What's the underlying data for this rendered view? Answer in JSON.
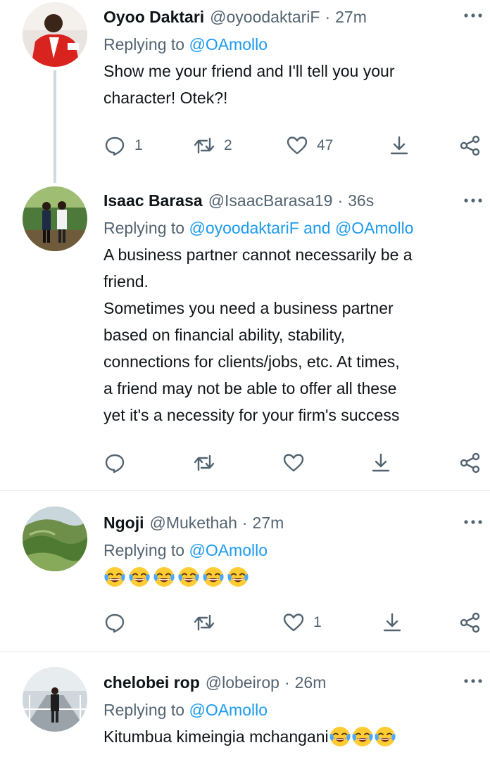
{
  "colors": {
    "text": "#0f1419",
    "muted": "#536471",
    "link": "#1d9bf0",
    "divider": "#e6ecf0",
    "thread": "#cfd9de"
  },
  "common": {
    "replying_prefix": "Replying to ",
    "dot": "·",
    "and": " and "
  },
  "tweets": [
    {
      "name": "Oyoo Daktari",
      "handle": "@oyoodaktariF",
      "time": "27m",
      "replying_to": [
        "@OAmollo"
      ],
      "text_lines": [
        "Show me your friend and I'll tell you your",
        "character! Otek?!"
      ],
      "reply_count": "1",
      "retweet_count": "2",
      "like_count": "47"
    },
    {
      "name": "Isaac Barasa",
      "handle": "@IsaacBarasa19",
      "time": "36s",
      "replying_to": [
        "@oyoodaktariF",
        "@OAmollo"
      ],
      "text_lines": [
        "A business partner cannot necessarily be a",
        "friend.",
        "Sometimes you need a business partner",
        "based on financial ability, stability,",
        "connections for clients/jobs, etc. At times,",
        "a friend may not be able to offer all these",
        "yet it's a necessity for your firm's success"
      ],
      "reply_count": "",
      "retweet_count": "",
      "like_count": ""
    },
    {
      "name": "Ngoji",
      "handle": "@Mukethah",
      "time": "27m",
      "replying_to": [
        "@OAmollo"
      ],
      "emoji_count": 6,
      "emoji": "face-with-tears-of-joy",
      "reply_count": "",
      "retweet_count": "",
      "like_count": "1"
    },
    {
      "name": "chelobei rop",
      "handle": "@lobeirop",
      "time": "26m",
      "replying_to": [
        "@OAmollo"
      ],
      "text": "Kitumbua kimeingia mchangani",
      "emoji_count": 3,
      "emoji": "face-with-tears-of-joy"
    }
  ]
}
